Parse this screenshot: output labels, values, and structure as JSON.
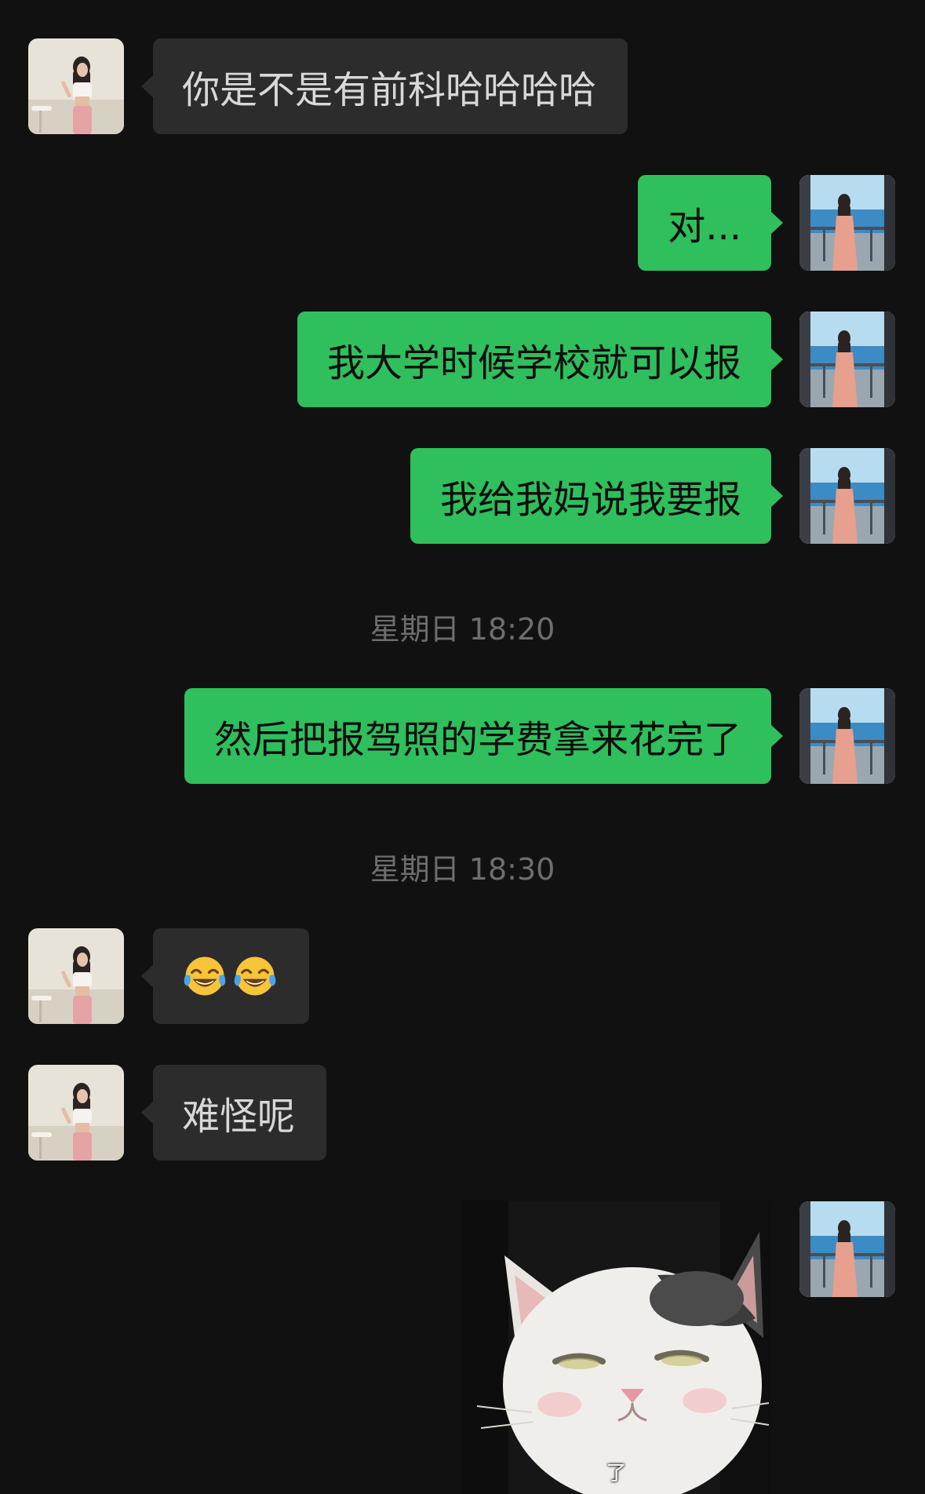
{
  "messages": {
    "m1": {
      "text": "你是不是有前科哈哈哈哈"
    },
    "m2": {
      "text": "对..."
    },
    "m3": {
      "text": "我大学时候学校就可以报"
    },
    "m4": {
      "text": "我给我妈说我要报"
    },
    "m5": {
      "text": "然后把报驾照的学费拿来花完了"
    },
    "m6": {
      "emoji": [
        "face-with-tears-of-joy-icon",
        "face-with-tears-of-joy-icon"
      ]
    },
    "m7": {
      "text": "难怪呢"
    },
    "m8": {
      "sticker_caption": "了"
    }
  },
  "timestamps": {
    "t1": "星期日 18:20",
    "t2": "星期日 18:30"
  },
  "colors": {
    "background": "#111111",
    "incoming_bubble": "#2c2c2c",
    "outgoing_bubble": "#2fbf5c",
    "timestamp_text": "#6e6e6e"
  }
}
